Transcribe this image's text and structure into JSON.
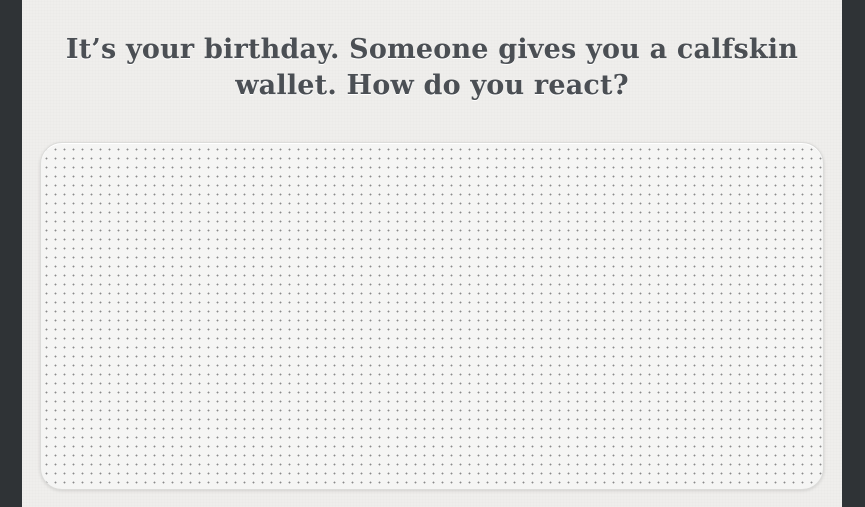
{
  "question": {
    "text": "It’s your birthday. Someone gives you a calfskin wallet. How do you react?"
  },
  "answer": {
    "value": "",
    "placeholder": ""
  },
  "colors": {
    "frame": "#2f3336",
    "paper": "#efeeec",
    "heading": "#4b4f54",
    "dot": "#8a8a8a"
  }
}
